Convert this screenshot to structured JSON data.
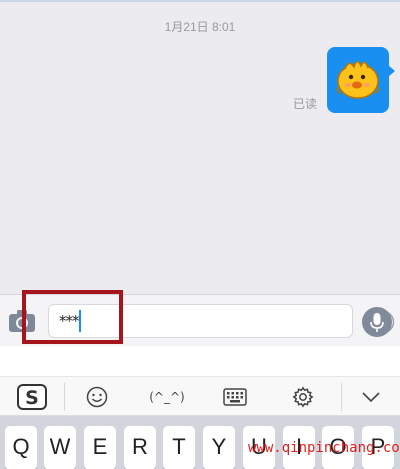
{
  "chat": {
    "timestamp": "1月21日 8:01",
    "read_status": "已读",
    "sticker_icon": "yellow-chick-emoji-sticker"
  },
  "input": {
    "value": "***",
    "camera_icon": "camera-icon",
    "emoji_icon": "smiley-icon",
    "mic_icon": "microphone-icon"
  },
  "ime_toolbar": {
    "logo_icon": "sogou-s-logo-icon",
    "emoji_icon": "smiley-icon",
    "kaomoji": "(^_^)",
    "keyboard_icon": "keyboard-icon",
    "settings_icon": "gear-icon",
    "collapse_icon": "chevron-down-icon"
  },
  "keyboard": {
    "keys": [
      "Q",
      "W",
      "E",
      "R",
      "T",
      "Y",
      "U",
      "I",
      "O",
      "P"
    ]
  },
  "watermark": "www.qinpinchang.com",
  "colors": {
    "bubble": "#1a8ff2",
    "highlight": "#a4161c",
    "watermark": "#e02020",
    "background": "#ebebf0"
  }
}
